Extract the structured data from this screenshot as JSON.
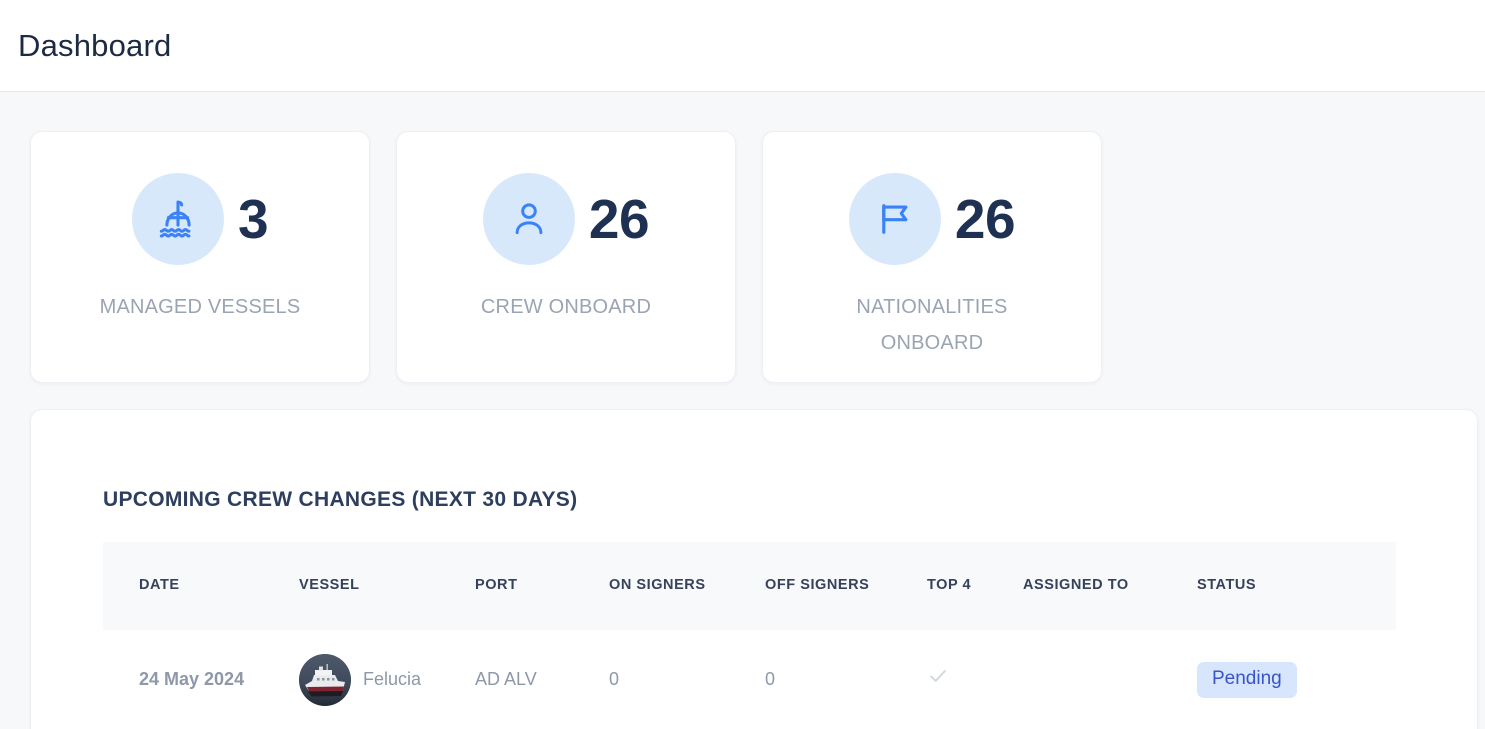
{
  "header": {
    "title": "Dashboard"
  },
  "stats": [
    {
      "icon": "ship-icon",
      "value": "3",
      "label": "MANAGED VESSELS"
    },
    {
      "icon": "person-icon",
      "value": "26",
      "label": "CREW ONBOARD"
    },
    {
      "icon": "flag-icon",
      "value": "26",
      "label": "NATIONALITIES ONBOARD"
    }
  ],
  "panel": {
    "title": "UPCOMING CREW CHANGES (NEXT 30 DAYS)",
    "table": {
      "columns": [
        "DATE",
        "VESSEL",
        "PORT",
        "ON SIGNERS",
        "OFF SIGNERS",
        "TOP 4",
        "ASSIGNED TO",
        "STATUS"
      ],
      "rows": [
        {
          "date": "24 May 2024",
          "vessel": "Felucia",
          "vessel_avatar": "vessel-photo",
          "port": "AD ALV",
          "on_signers": "0",
          "off_signers": "0",
          "top4": "check-icon",
          "assigned_to": "",
          "status": "Pending"
        }
      ]
    }
  },
  "colors": {
    "accent": "#3b82f6",
    "icon_circle_bg": "#d8e8fb",
    "stat_value": "#1f3153",
    "badge_bg": "#d7e5fd",
    "badge_text": "#3755c9",
    "page_bg": "#f7f8fa",
    "table_header_bg": "#f7f9fb"
  }
}
